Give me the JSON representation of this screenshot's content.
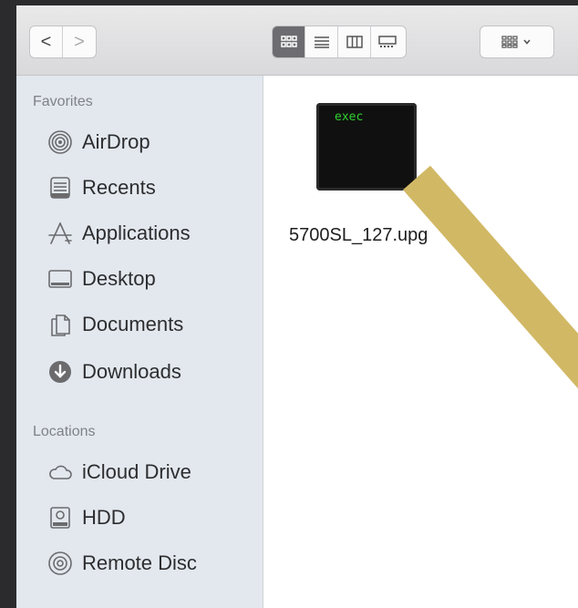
{
  "toolbar": {
    "back_label": "<",
    "forward_label": ">",
    "view_buttons": [
      "icon-view",
      "list-view",
      "column-view",
      "gallery-view"
    ],
    "group_button": "group-by"
  },
  "sidebar": {
    "favorites_label": "Favorites",
    "favorites": [
      {
        "label": "AirDrop",
        "icon": "airdrop-icon"
      },
      {
        "label": "Recents",
        "icon": "recents-icon"
      },
      {
        "label": "Applications",
        "icon": "applications-icon"
      },
      {
        "label": "Desktop",
        "icon": "desktop-icon"
      },
      {
        "label": "Documents",
        "icon": "documents-icon"
      },
      {
        "label": "Downloads",
        "icon": "downloads-icon"
      }
    ],
    "locations_label": "Locations",
    "locations": [
      {
        "label": "iCloud Drive",
        "icon": "icloud-icon"
      },
      {
        "label": "HDD",
        "icon": "hdd-icon"
      },
      {
        "label": "Remote Disc",
        "icon": "remote-disc-icon"
      }
    ]
  },
  "content": {
    "file": {
      "icon_text": "exec",
      "name": "5700SL_127.upg"
    }
  },
  "colors": {
    "arrow": "#d1b865",
    "sidebar_bg": "#e2e8ee",
    "active_view": "#6d6d71",
    "terminal_text": "#2fd12f"
  }
}
